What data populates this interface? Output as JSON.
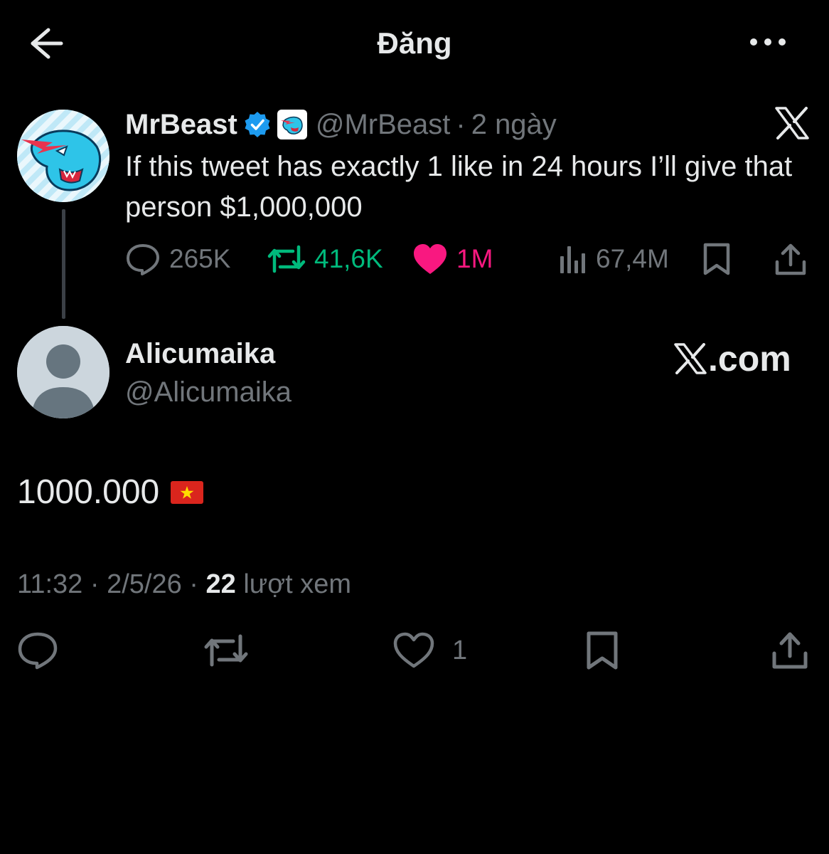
{
  "header": {
    "title": "Đăng"
  },
  "quoted_tweet": {
    "author_name": "MrBeast",
    "handle": "@MrBeast",
    "separator": "·",
    "time": "2 ngày",
    "text": "If this tweet has exactly 1 like in 24 hours I’ll give that person $1,000,000",
    "replies": "265K",
    "reposts": "41,6K",
    "likes": "1M",
    "views": "67,4M",
    "colors": {
      "repost": "#00ba7c",
      "like": "#f91880",
      "verified": "#1d9bf0"
    }
  },
  "reply": {
    "author_name": "Alicumaika",
    "handle": "@Alicumaika",
    "watermark": ".com",
    "text": "1000.000",
    "flag": "vietnam-flag",
    "meta": {
      "time": "11:32",
      "sep1": " · ",
      "date": "2/5/26",
      "sep2": " · ",
      "views_count": "22",
      "views_label": " lượt xem"
    },
    "likes": "1"
  }
}
